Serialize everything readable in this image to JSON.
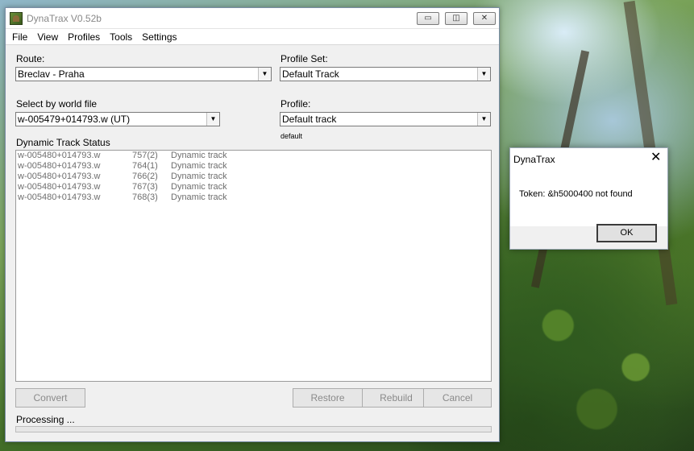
{
  "window": {
    "title": "DynaTrax V0.52b",
    "controls": {
      "minimize": "▭",
      "maximize": "◫",
      "close": "✕"
    }
  },
  "menu": [
    "File",
    "View",
    "Profiles",
    "Tools",
    "Settings"
  ],
  "route": {
    "label": "Route:",
    "value": "Breclav - Praha"
  },
  "profile_set": {
    "label": "Profile Set:",
    "value": "Default Track"
  },
  "world_file": {
    "label": "Select by world file",
    "value": "w-005479+014793.w (UT)"
  },
  "profile": {
    "label": "Profile:",
    "value": "Default track",
    "note": "default"
  },
  "status": {
    "label": "Dynamic Track Status",
    "rows": [
      {
        "file": "w-005480+014793.w",
        "id": "757(2)",
        "type": "Dynamic track"
      },
      {
        "file": "w-005480+014793.w",
        "id": "764(1)",
        "type": "Dynamic track"
      },
      {
        "file": "w-005480+014793.w",
        "id": "766(2)",
        "type": "Dynamic track"
      },
      {
        "file": "w-005480+014793.w",
        "id": "767(3)",
        "type": "Dynamic track"
      },
      {
        "file": "w-005480+014793.w",
        "id": "768(3)",
        "type": "Dynamic track"
      }
    ]
  },
  "buttons": {
    "convert": "Convert",
    "restore": "Restore",
    "rebuild": "Rebuild",
    "cancel": "Cancel"
  },
  "processing": "Processing ...",
  "dialog": {
    "title": "DynaTrax",
    "close": "✕",
    "message": "Token: &h5000400 not found",
    "ok": "OK"
  }
}
